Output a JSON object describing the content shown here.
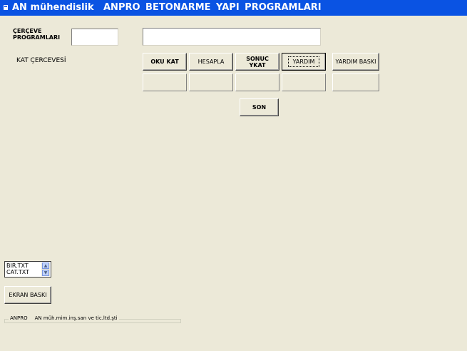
{
  "titlebar": {
    "left": "AN mühendislik",
    "right": "ANPRO  BETONARME  YAPI  PROGRAMLARI",
    "icon": "app-icon"
  },
  "frame_programs_label_line1": "ÇERÇEVE",
  "frame_programs_label_line2": "PROGRAMLARI",
  "kat_label": "KAT ÇERCEVESİ",
  "buttons": {
    "oku_kat": "OKU  KAT",
    "hesapla": "HESAPLA",
    "sonuc_line1": "SONUC",
    "sonuc_line2": "YKAT",
    "yardim": "YARDIM",
    "yardim_baski": "YARDIM BASKI",
    "son": "SON",
    "ekran_baski": "EKRAN BASKI"
  },
  "file_list": [
    "BIR.TXT",
    "CAT.TXT"
  ],
  "status": {
    "left": "ANPRO",
    "right": "AN müh.mim.inş.san ve tic.ltd.şti"
  },
  "colors": {
    "titlebar": "#0a53e3",
    "background": "#ece9d8"
  }
}
